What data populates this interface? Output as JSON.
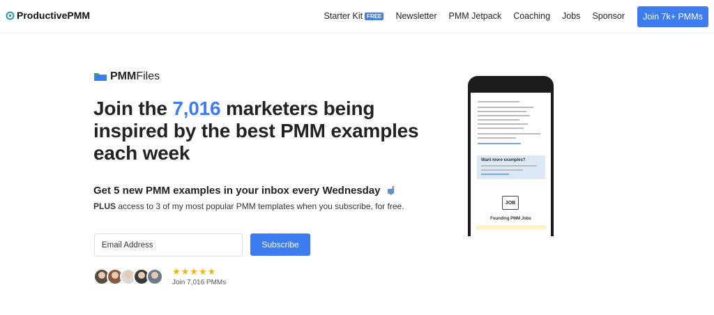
{
  "nav": {
    "logo": "ProductivePMM",
    "links": [
      {
        "label": "Starter Kit",
        "badge": "FREE"
      },
      {
        "label": "Newsletter"
      },
      {
        "label": "PMM Jetpack"
      },
      {
        "label": "Coaching"
      },
      {
        "label": "Jobs"
      },
      {
        "label": "Sponsor"
      }
    ],
    "cta": "Join 7k+ PMMs"
  },
  "hero": {
    "brand_bold": "PMM",
    "brand_light": "Files",
    "headline_pre": "Join the ",
    "headline_num": "7,016",
    "headline_post": " marketers being inspired by the best PMM examples each week",
    "subhead": "Get 5 new PMM examples in your inbox every Wednesday",
    "plus_bold": "PLUS",
    "plus_rest": " access to 3 of my most popular PMM templates when you subscribe, for free.",
    "email_placeholder": "Email Address",
    "subscribe": "Subscribe",
    "stars": "★★★★★",
    "join_count": "Join 7,016 PMMs"
  },
  "phone": {
    "card_title": "Want more examples?",
    "job_icon": "JOB",
    "jobs_title": "Founding PMM Jobs"
  },
  "colors": {
    "accent": "#3d7cf0",
    "star": "#f4b400"
  }
}
